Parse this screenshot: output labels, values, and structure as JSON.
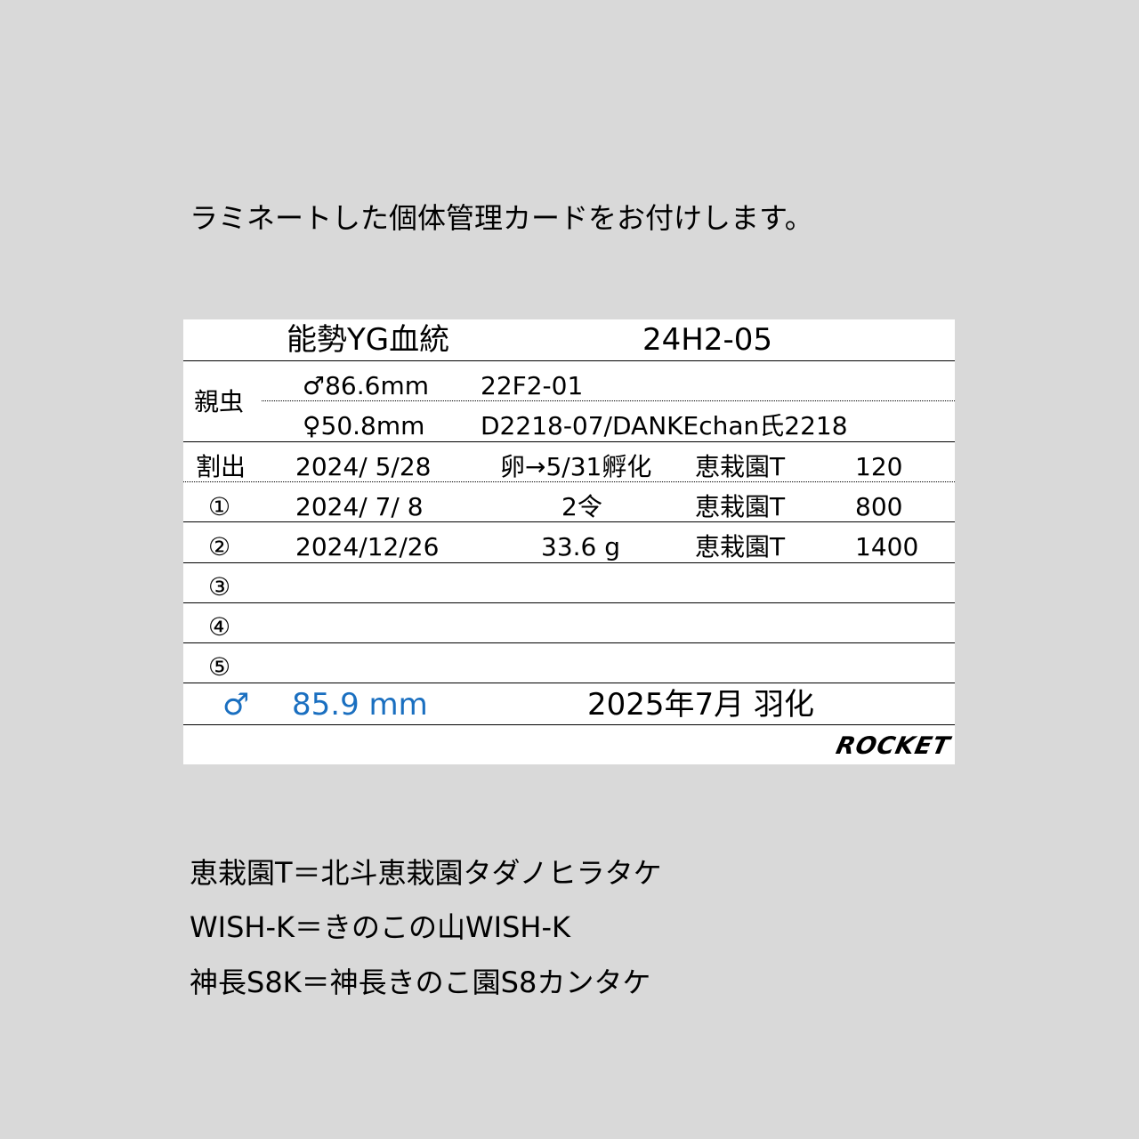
{
  "intro": "ラミネートした個体管理カードをお付けします。",
  "card": {
    "lineage": "能勢YG血統",
    "id": "24H2-05",
    "parents": {
      "label": "親虫",
      "male_size": "♂86.6mm",
      "male_id": "22F2-01",
      "female_size": "♀50.8mm",
      "female_id": "D2218-07/DANKEchan氏2218"
    },
    "rows": [
      {
        "label": "割出",
        "date": "2024/  5/28",
        "note": "卵→5/31孵化",
        "substrate": "恵栽園T",
        "volume": "120"
      },
      {
        "label": "①",
        "date": "2024/  7/  8",
        "note": "2令",
        "substrate": "恵栽園T",
        "volume": "800"
      },
      {
        "label": "②",
        "date": "2024/12/26",
        "note": "33.6 g",
        "substrate": "恵栽園T",
        "volume": "1400"
      },
      {
        "label": "③",
        "date": "",
        "note": "",
        "substrate": "",
        "volume": ""
      },
      {
        "label": "④",
        "date": "",
        "note": "",
        "substrate": "",
        "volume": ""
      },
      {
        "label": "⑤",
        "date": "",
        "note": "",
        "substrate": "",
        "volume": ""
      }
    ],
    "result": {
      "sex": "♂",
      "size": "85.9 mm",
      "emergence": "2025年7月 羽化"
    },
    "brand": "ROCKET",
    "accent_color": "#1a6fc0"
  },
  "legend": [
    "恵栽園T＝北斗恵栽園タダノヒラタケ",
    "WISH-K＝きのこの山WISH-K",
    "神長S8K＝神長きのこ園S8カンタケ"
  ]
}
